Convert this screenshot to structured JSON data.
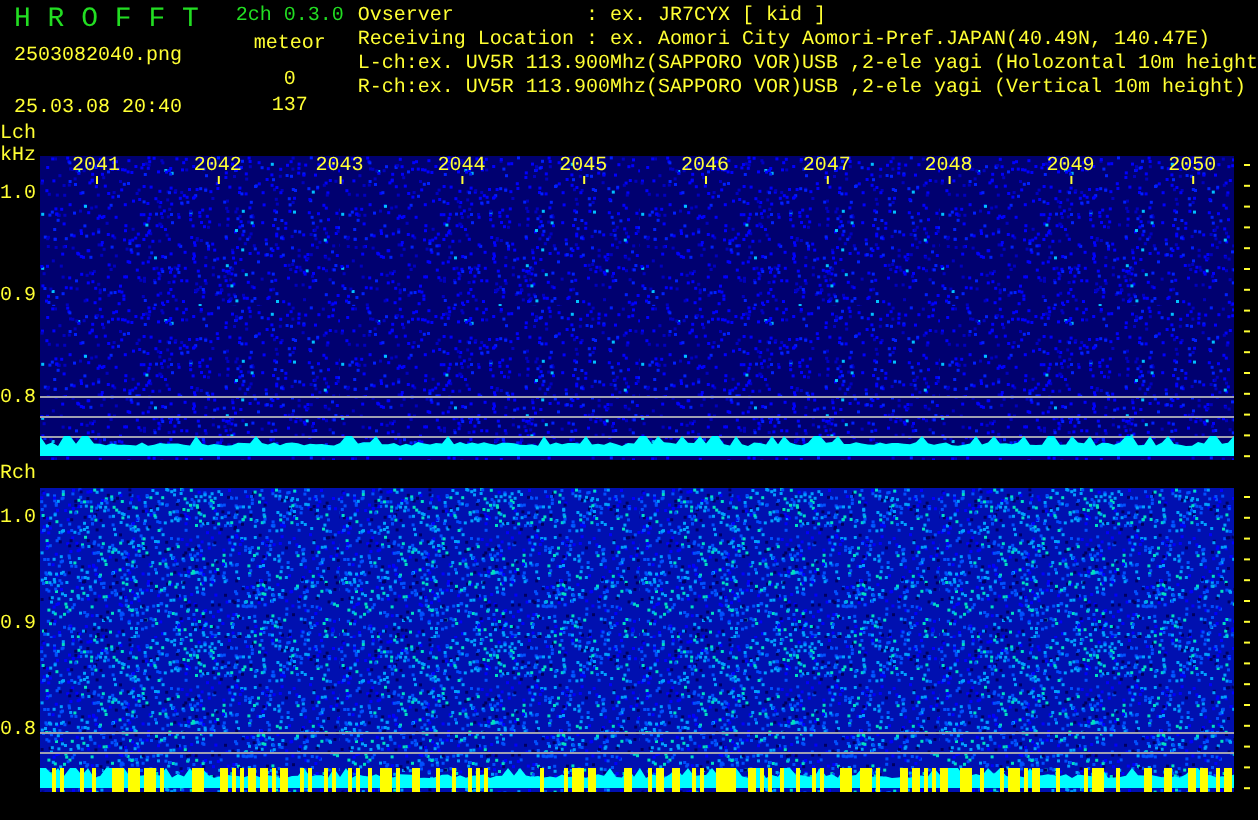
{
  "header": {
    "title": "H R O F F T",
    "version": "2ch 0.3.0",
    "filename": "2503082040.png",
    "datetime": "25.03.08 20:40",
    "meteor_label": "meteor",
    "counts": [
      "0",
      "137"
    ],
    "info": [
      {
        "label": "Ovserver",
        "separator": ":",
        "value": "ex. JR7CYX [ kid ]"
      },
      {
        "label": "Receiving Location",
        "separator": ":",
        "value": "ex. Aomori City Aomori-Pref.JAPAN(40.49N, 140.47E)"
      }
    ],
    "channel_lines": [
      "L-ch:ex. UV5R 113.900Mhz(SAPPORO VOR)USB ,2-ele yagi (Holozontal 10m height",
      "R-ch:ex. UV5R 113.900Mhz(SAPPORO VOR)USB ,2-ele yagi (Vertical 10m height)"
    ]
  },
  "time_labels": [
    "2041",
    "2042",
    "2043",
    "2044",
    "2045",
    "2046",
    "2047",
    "2048",
    "2049",
    "2050"
  ],
  "channels": [
    {
      "name": "Lch",
      "unit": "kHz",
      "kind": "quiet",
      "y_labels": [
        "1.0",
        "0.9",
        "0.8"
      ]
    },
    {
      "name": "Rch",
      "kind": "busy",
      "y_labels": [
        "1.0",
        "0.9",
        "0.8"
      ]
    }
  ]
}
